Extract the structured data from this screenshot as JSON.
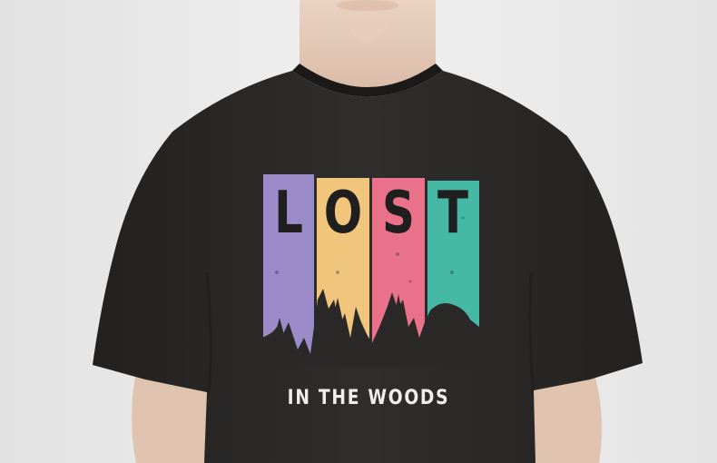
{
  "colors": {
    "background": "#ececec",
    "shirt": "#2b2927",
    "skin": "#e3c8b4",
    "stripe_purple": "#9b8bc9",
    "stripe_yellow": "#f1c57b",
    "stripe_pink": "#e9718a",
    "stripe_teal": "#45b8a6",
    "letter": "#1f1f1f",
    "tagline": "#eeeeee"
  },
  "print": {
    "letters": [
      "L",
      "O",
      "S",
      "T"
    ],
    "tagline": "IN THE WOODS"
  }
}
